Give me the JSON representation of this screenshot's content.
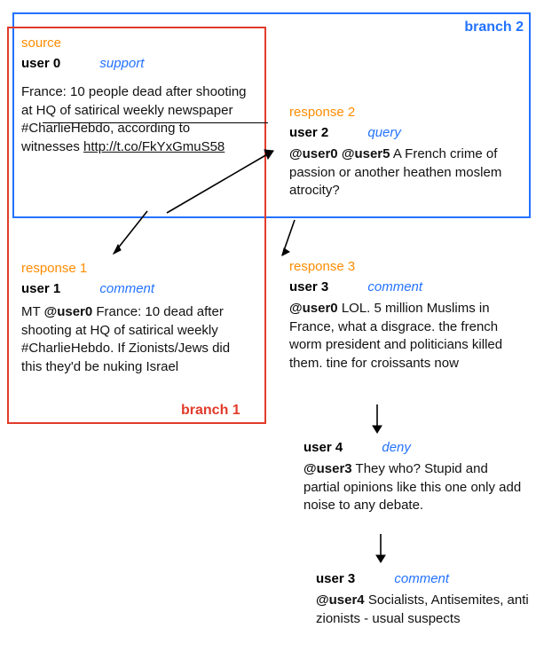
{
  "branches": {
    "branch1": {
      "label": "branch 1",
      "color": "#e23b2b"
    },
    "branch2": {
      "label": "branch 2",
      "color": "#2372ff"
    }
  },
  "posts": {
    "source": {
      "tag": "source",
      "user": "user 0",
      "stance": "support",
      "body_pre": "France: 10 people dead after shooting at HQ of satirical weekly newspaper #CharlieHebdo, according to witnesses ",
      "link": "http://t.co/FkYxGmuS58"
    },
    "r1": {
      "tag": "response 1",
      "user": "user 1",
      "stance": "comment",
      "pre": "MT ",
      "mention": "@user0",
      "body": " France: 10 dead after shooting at HQ of satirical weekly #CharlieHebdo. If Zionists/Jews did this they'd be nuking Israel"
    },
    "r2": {
      "tag": "response 2",
      "user": "user 2",
      "stance": "query",
      "mention": "@user0 @user5",
      "body": " A French crime of passion or another heathen moslem atrocity?"
    },
    "r3": {
      "tag": "response 3",
      "user": "user 3",
      "stance": "comment",
      "mention": "@user0",
      "body": " LOL. 5 million Muslims in France, what a disgrace. the french worm president and politicians killed them. tine for croissants now"
    },
    "r4": {
      "user": "user 4",
      "stance": "deny",
      "mention": "@user3",
      "body": " They who? Stupid and partial opinions like this one only add noise to any debate."
    },
    "r5": {
      "user": "user 3",
      "stance": "comment",
      "mention": "@user4",
      "body": " Socialists, Antisemites, anti zionists - usual suspects"
    }
  }
}
